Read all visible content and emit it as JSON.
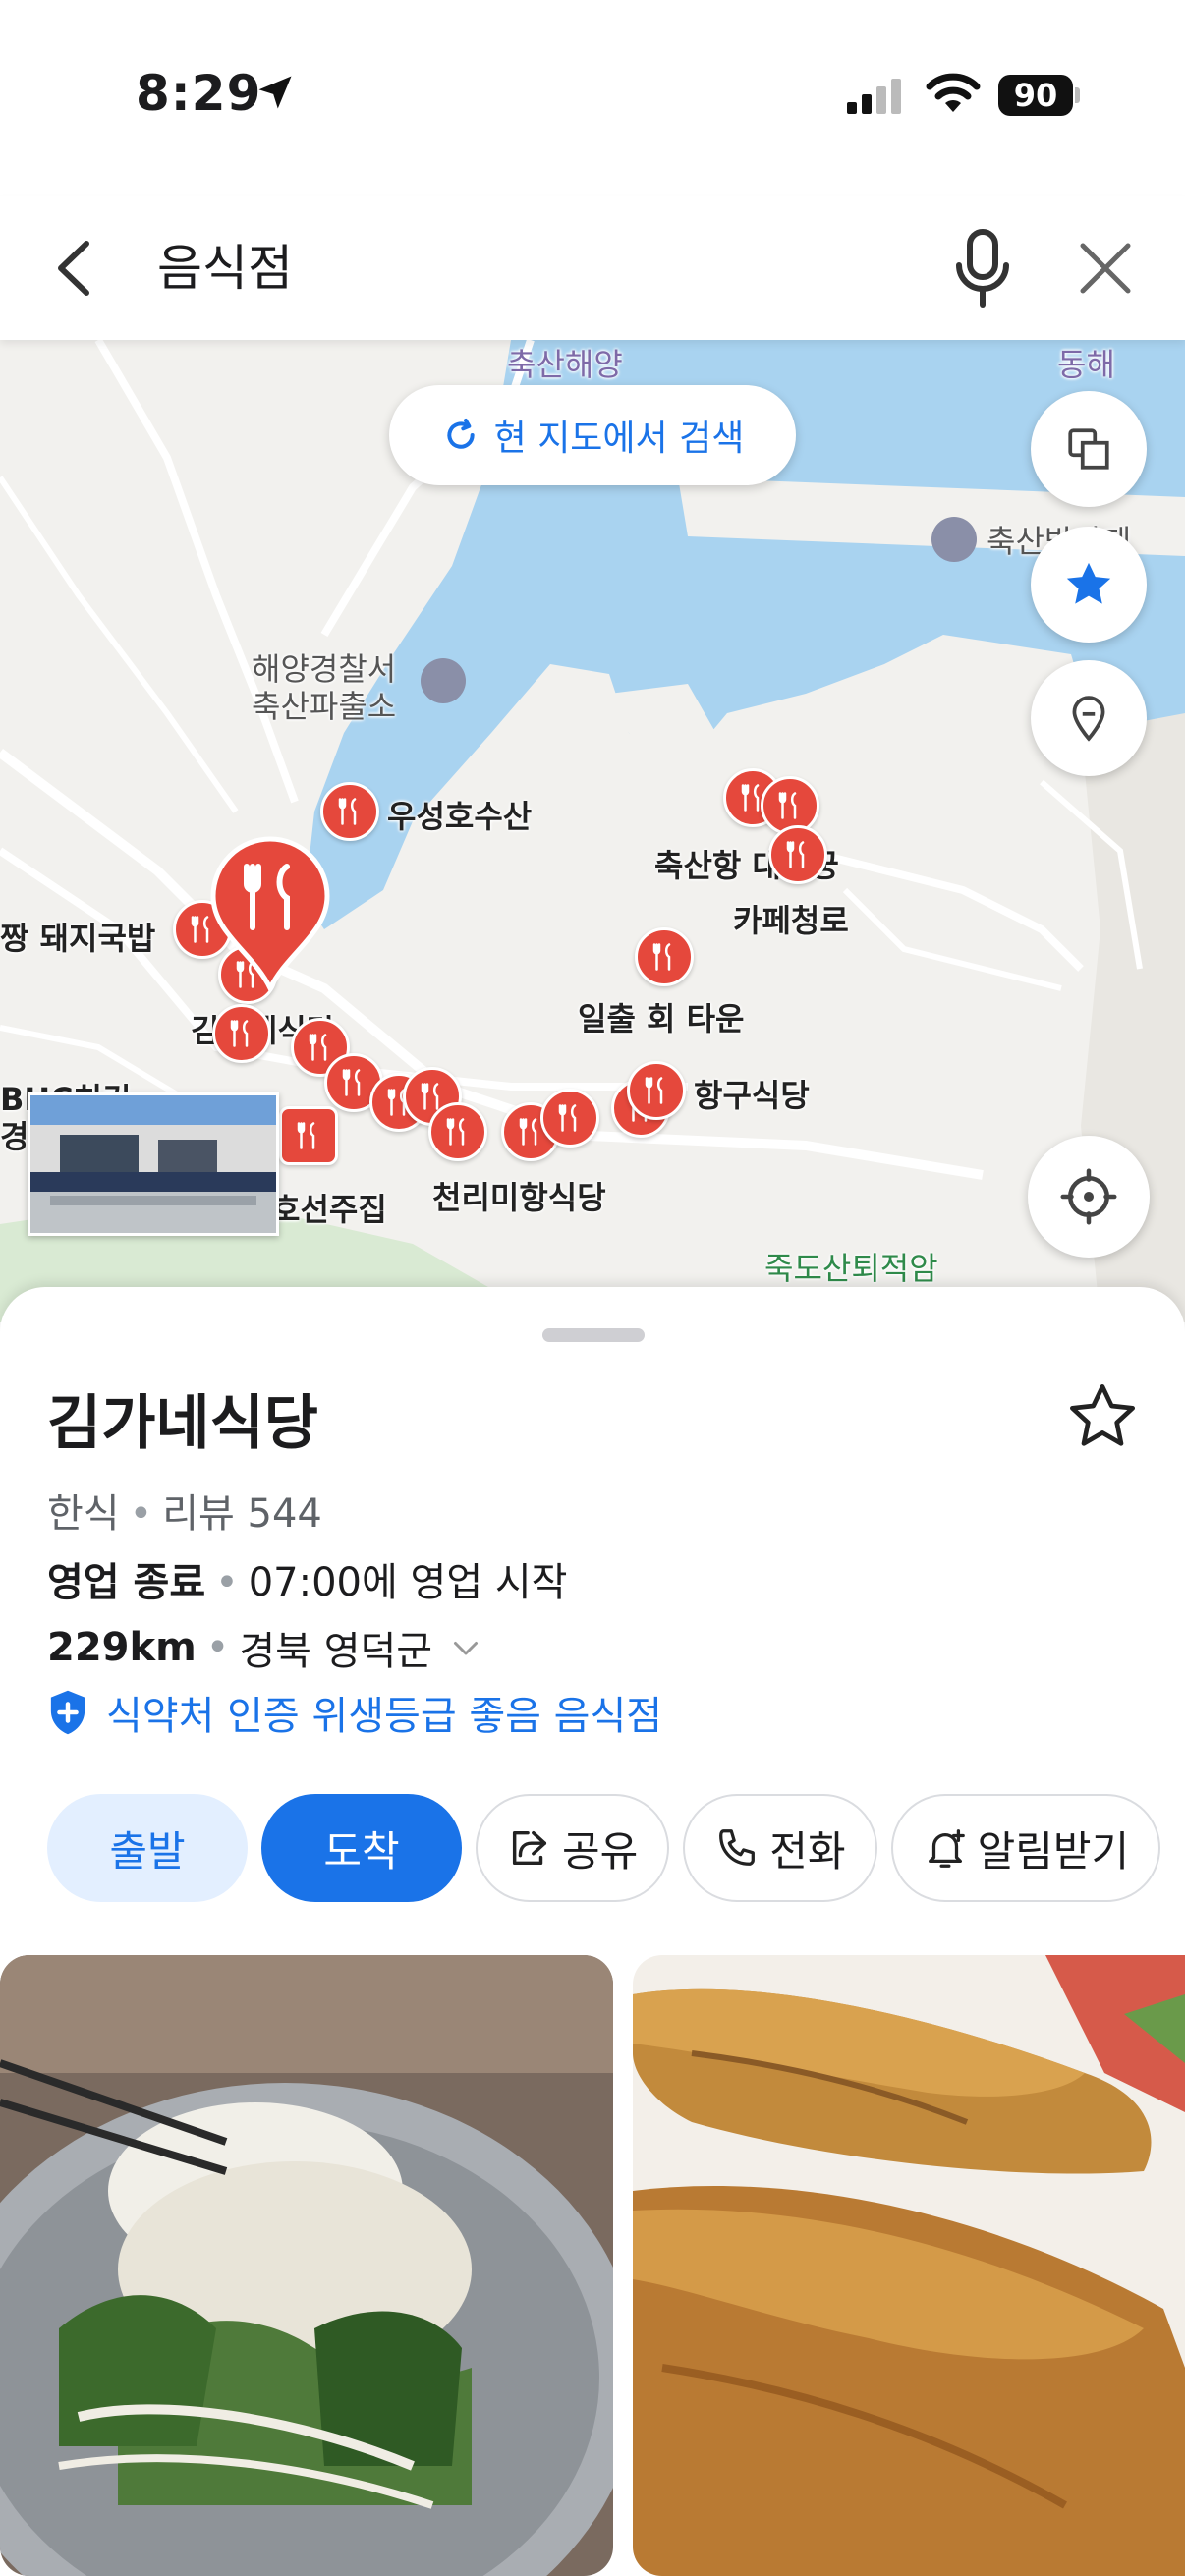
{
  "status_bar": {
    "time": "8:29",
    "battery": "90"
  },
  "search": {
    "query": "음식점"
  },
  "map": {
    "search_area_label": "현 지도에서 검색",
    "labels": {
      "chuksan_haeyang": "축산해양",
      "donghae": "동해",
      "ferry": "축산방파제",
      "police_1": "해양경찰서",
      "police_2": "축산파출소",
      "wooseong": "우성호수산",
      "daegegung": "축산항 대게궁",
      "cafe": "카페청로",
      "pork": "짱 돼지국밥",
      "ilchul": "일출 회 타운",
      "gimga": "김가네식당",
      "hanggu": "항구식당",
      "bhc": "BHC치킨",
      "gyeongbuk": "경북",
      "hoseon": "호선주집",
      "cheonrimi": "천리미항식당",
      "jukdo": "죽도산퇴적암"
    }
  },
  "place": {
    "name": "김가네식당",
    "category": "한식",
    "review_label": "리뷰 544",
    "status": "영업 종료",
    "hours_note": "07:00에 영업 시작",
    "distance": "229km",
    "region": "경북 영덕군",
    "certification": "식약처 인증 위생등급 좋음 음식점"
  },
  "actions": {
    "depart": "출발",
    "arrive": "도착",
    "share": "공유",
    "call": "전화",
    "notify": "알림받기"
  },
  "colors": {
    "accent": "#1a73e8",
    "pin": "#e5483c",
    "sea": "#a9d3f0",
    "land": "#f2f1ee"
  }
}
